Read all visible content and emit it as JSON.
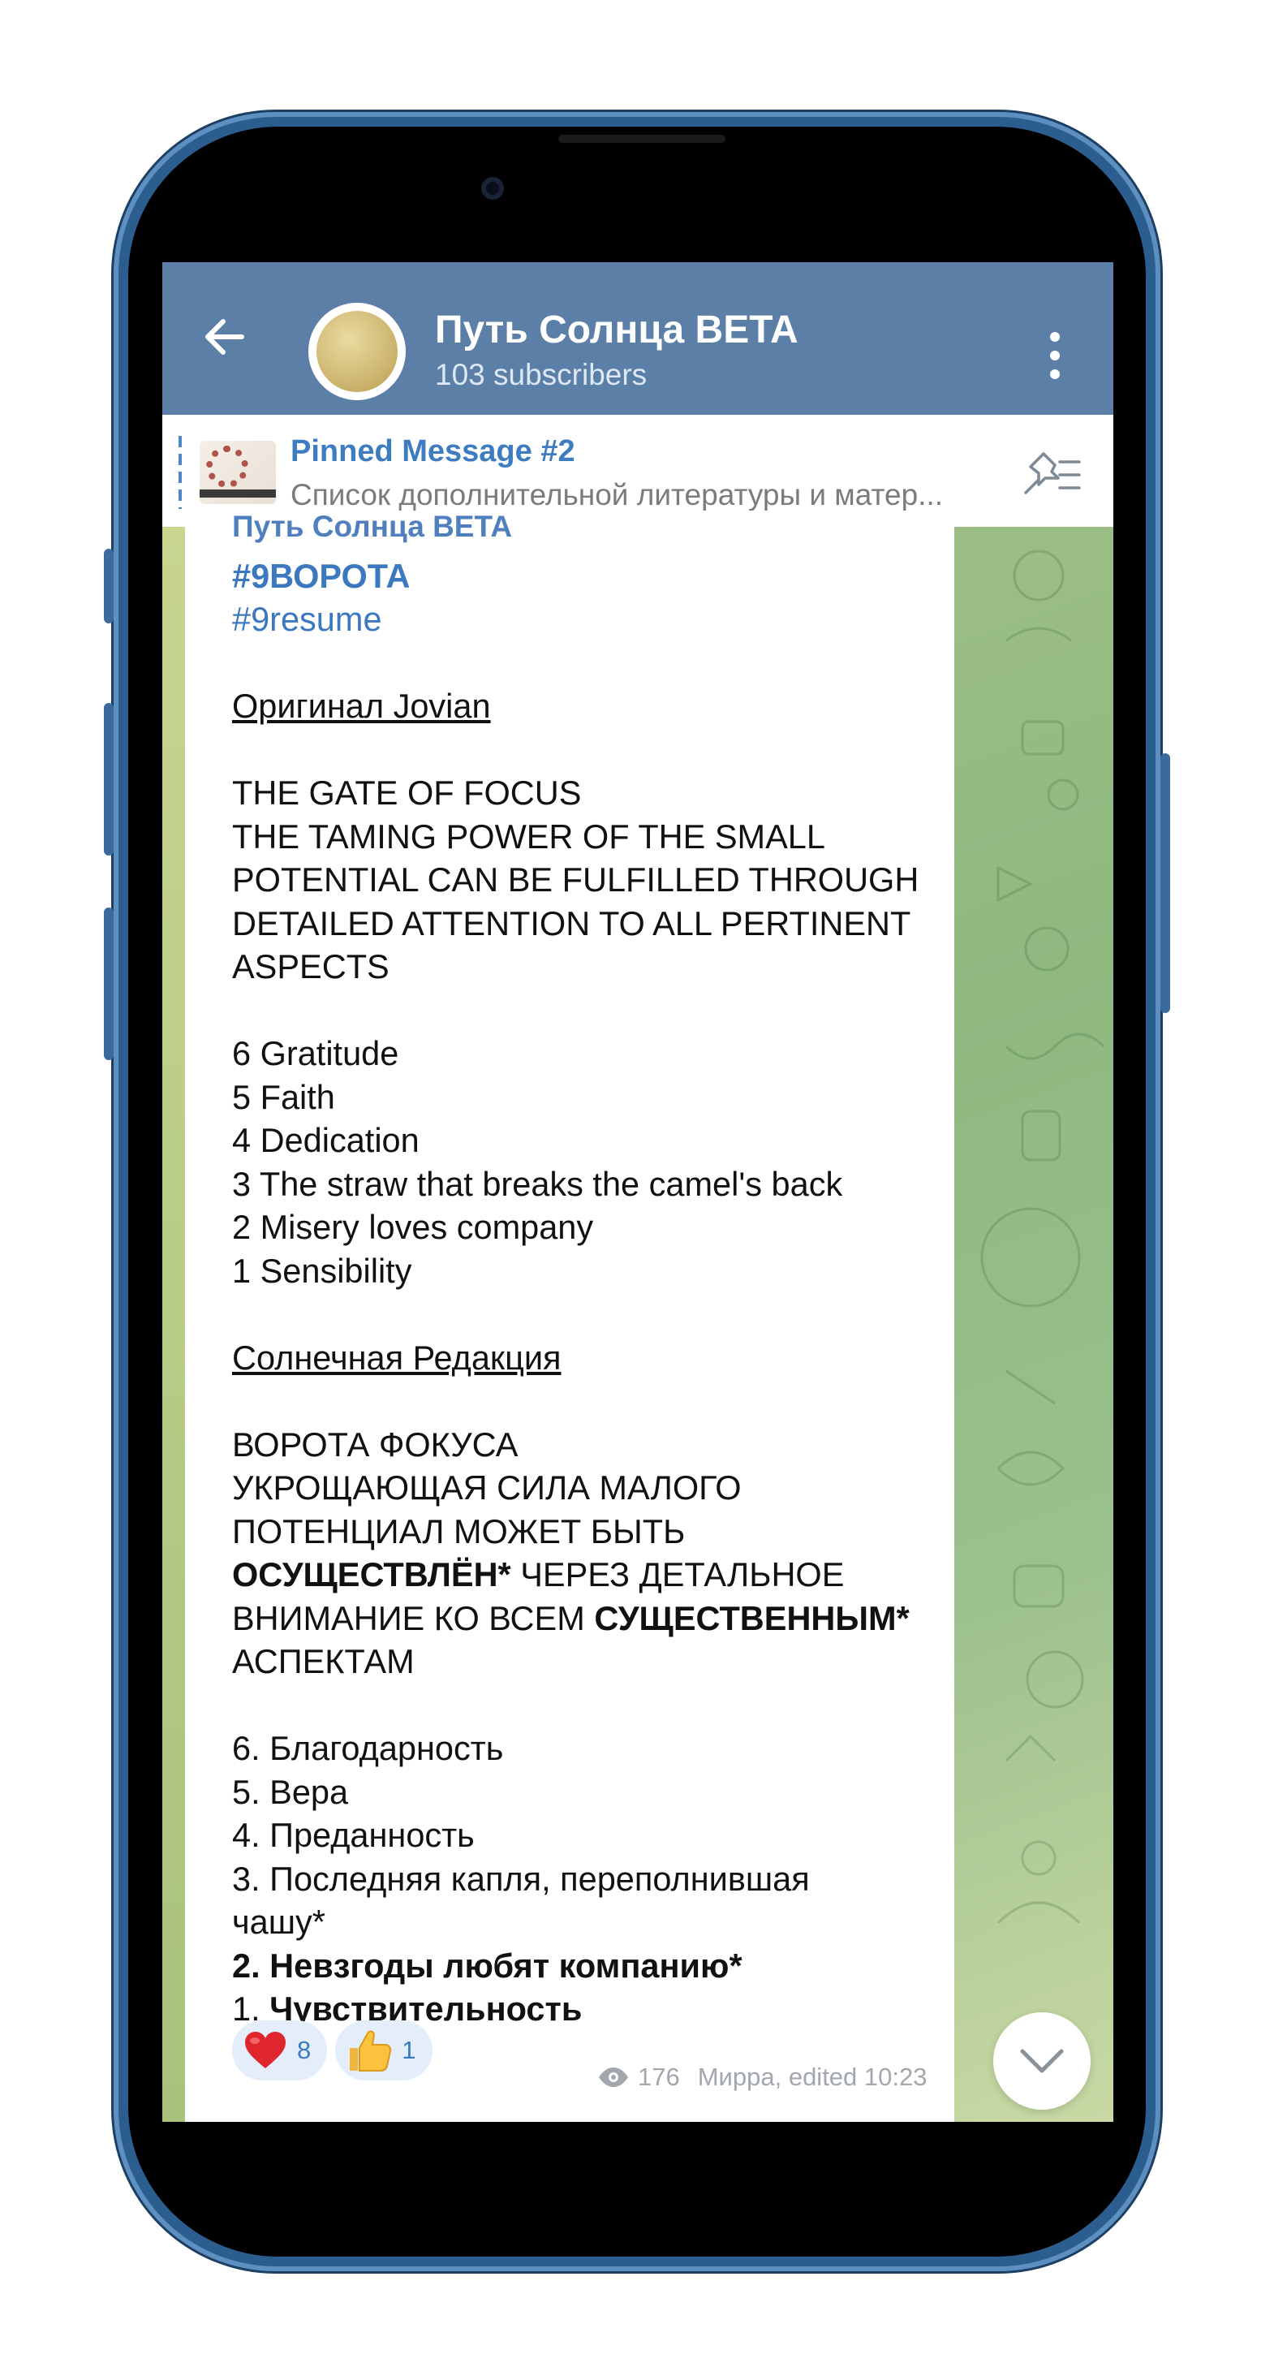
{
  "header": {
    "back_icon": "arrow-left-icon",
    "channel_title": "Путь Солнца BETA",
    "subscribers": "103 subscribers",
    "menu_icon": "more-vertical-icon"
  },
  "pinned": {
    "title": "Pinned Message #2",
    "preview": "Список дополнительной литературы и матер..."
  },
  "message": {
    "author": "Путь Солнца BETA",
    "hashtag_main": "#9ВОРОТА",
    "hashtag_sub": "#9resume",
    "section_original": "Оригинал Jovian",
    "original_lines": [
      "THE GATE OF FOCUS",
      "THE TAMING POWER OF THE SMALL",
      "POTENTIAL CAN BE FULFILLED THROUGH",
      "DETAILED ATTENTION TO ALL PERTINENT",
      "ASPECTS"
    ],
    "original_list": [
      "6 Gratitude",
      "5 Faith",
      "4 Dedication",
      "3 The straw that breaks the camel's back",
      "2 Misery loves company",
      "1 Sensibility"
    ],
    "section_solar": "Солнечная Редакция",
    "solar_line1": "ВОРОТА ФОКУСА",
    "solar_line2": "УКРОЩАЮЩАЯ СИЛА МАЛОГО",
    "solar_line3": "ПОТЕНЦИАЛ МОЖЕТ БЫТЬ",
    "solar_line4_bold": "ОСУЩЕСТВЛЁН*",
    "solar_line4_rest": " ЧЕРЕЗ ДЕТАЛЬНОЕ",
    "solar_line5_start": "ВНИМАНИЕ КО ВСЕМ ",
    "solar_line5_bold": "СУЩЕСТВЕННЫМ*",
    "solar_line6": "АСПЕКТАМ",
    "solar_list_6": "6. Благодарность",
    "solar_list_5": "5. Вера",
    "solar_list_4": "4. Преданность",
    "solar_list_3a": "3. Последняя капля, переполнившая",
    "solar_list_3b": "чашу*",
    "solar_list_2": "2. Невзгоды любят компанию*",
    "solar_list_1_num": "1. ",
    "solar_list_1_bold": "Чувствительность"
  },
  "reactions": [
    {
      "emoji_icon": "red-heart-icon",
      "count": "8"
    },
    {
      "emoji_icon": "thumbs-up-icon",
      "count": "1"
    }
  ],
  "footer": {
    "views_icon": "eye-icon",
    "views": "176",
    "signature": "Мирра, edited 10:23"
  },
  "colors": {
    "header_bg": "#5b7fa7",
    "link": "#3b78bf",
    "chat_bg": "#9bbf88"
  }
}
